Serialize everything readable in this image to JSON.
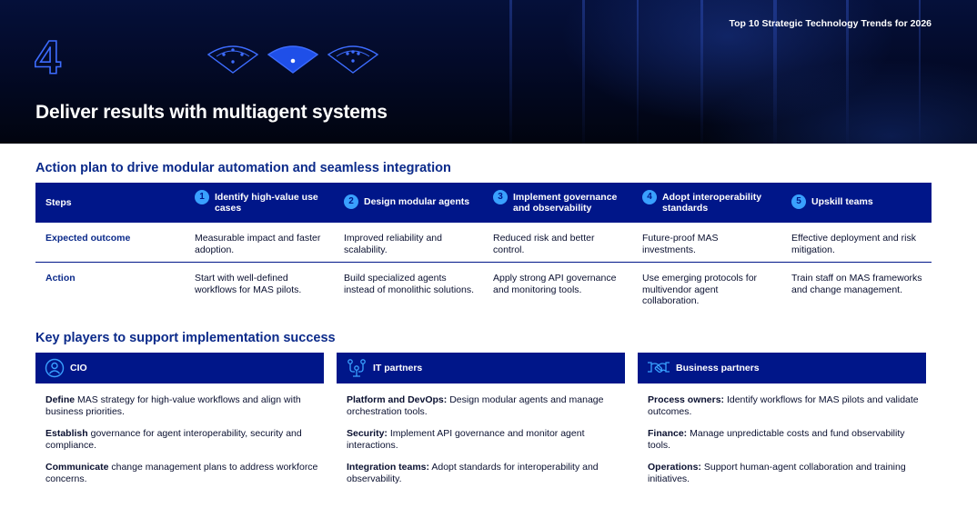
{
  "hero": {
    "header": "Top 10 Strategic Technology Trends for 2026",
    "number": "4",
    "title": "Deliver results with multiagent systems"
  },
  "action_plan": {
    "title": "Action plan to drive modular automation and seamless integration",
    "steps_label": "Steps",
    "steps": [
      {
        "number": "1",
        "label": "Identify high-value use cases"
      },
      {
        "number": "2",
        "label": "Design modular agents"
      },
      {
        "number": "3",
        "label": "Implement governance and observability"
      },
      {
        "number": "4",
        "label": "Adopt interoperability standards"
      },
      {
        "number": "5",
        "label": "Upskill teams"
      }
    ],
    "outcome_label": "Expected outcome",
    "outcomes": [
      "Measurable impact and faster adoption.",
      "Improved reliability and scalability.",
      "Reduced risk and better control.",
      "Future-proof MAS investments.",
      "Effective deployment and risk mitigation."
    ],
    "action_label": "Action",
    "actions": [
      "Start with well-defined workflows for MAS pilots.",
      "Build specialized agents instead of monolithic solutions.",
      "Apply strong API governance and monitoring tools.",
      "Use emerging protocols for multivendor agent collaboration.",
      "Train staff on MAS frameworks and change management."
    ]
  },
  "key_players": {
    "title": "Key players to support implementation success",
    "groups": [
      {
        "name": "CIO",
        "icon": "person-badge-icon",
        "items": [
          {
            "lead": "Define",
            "text": " MAS strategy for high-value workflows and align with business priorities."
          },
          {
            "lead": "Establish",
            "text": " governance for agent interoperability, security and compliance."
          },
          {
            "lead": "Communicate",
            "text": " change management plans to address workforce concerns."
          }
        ]
      },
      {
        "name": "IT partners",
        "icon": "network-people-icon",
        "items": [
          {
            "lead": "Platform and DevOps:",
            "text": " Design modular agents and manage orchestration tools."
          },
          {
            "lead": "Security:",
            "text": " Implement API governance and monitor agent interactions."
          },
          {
            "lead": "Integration teams:",
            "text": " Adopt standards for interoperability and observability."
          }
        ]
      },
      {
        "name": "Business partners",
        "icon": "handshake-icon",
        "items": [
          {
            "lead": "Process owners:",
            "text": " Identify workflows for MAS pilots and validate outcomes."
          },
          {
            "lead": "Finance:",
            "text": " Manage unpredictable costs and fund observability tools."
          },
          {
            "lead": "Operations:",
            "text": " Support human-agent collaboration and training initiatives."
          }
        ]
      }
    ]
  },
  "colors": {
    "navy": "#001689",
    "heading_blue": "#0b2a8a",
    "accent_blue": "#39a0ff",
    "hero_dark": "#030a28"
  }
}
